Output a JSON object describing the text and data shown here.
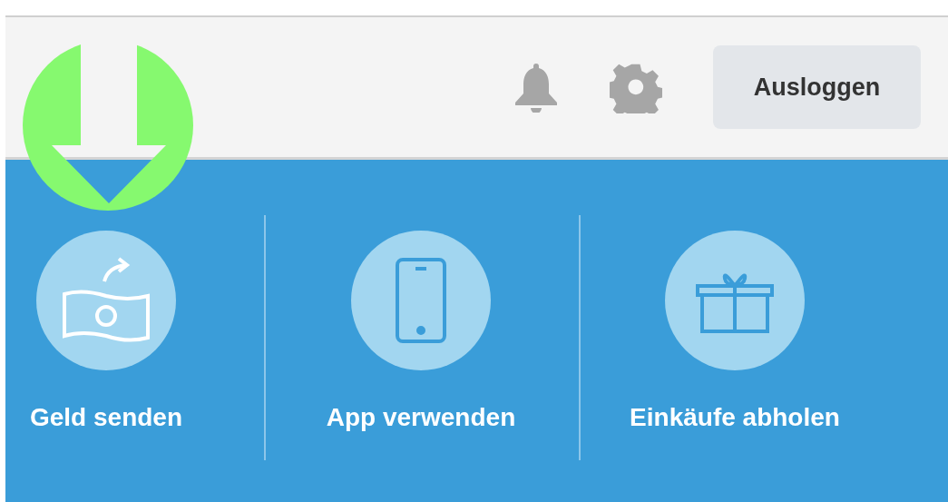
{
  "header": {
    "logout_button": "Ausloggen"
  },
  "actions": [
    {
      "kind": "money",
      "label": "Geld senden"
    },
    {
      "kind": "phone",
      "label": "App verwenden"
    },
    {
      "kind": "gift",
      "label": "Einkäufe abholen"
    }
  ]
}
